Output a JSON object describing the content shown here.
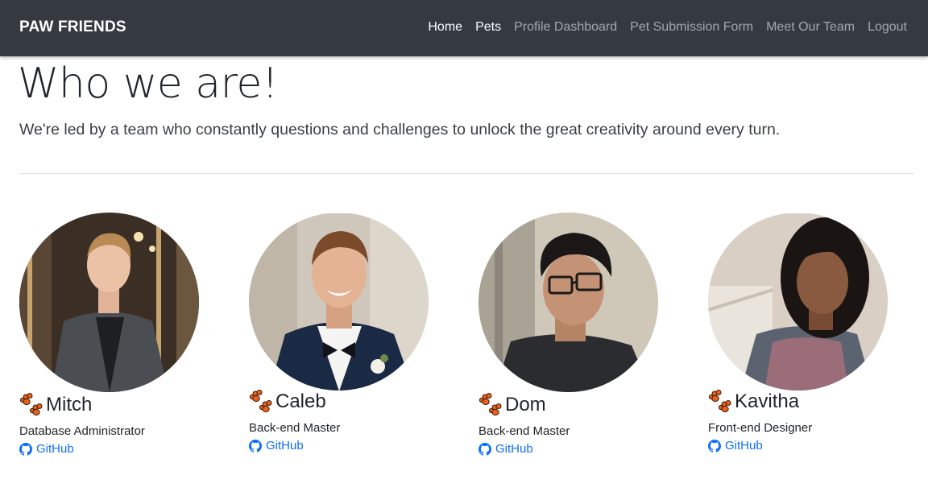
{
  "navbar": {
    "brand": "PAW FRIENDS",
    "links": [
      "Home",
      "Pets",
      "Profile Dashboard",
      "Pet Submission Form",
      "Meet Our Team",
      "Logout"
    ]
  },
  "hero": {
    "title": "Who we are!",
    "lead": "We're led by a team who constantly questions and challenges to unlock the great creativity around every turn."
  },
  "team": [
    {
      "name": "Mitch",
      "role": "Database Administrator",
      "link": "GitHub"
    },
    {
      "name": "Caleb",
      "role": "Back-end Master",
      "link": "GitHub"
    },
    {
      "name": "Dom",
      "role": "Back-end Master",
      "link": "GitHub"
    },
    {
      "name": "Kavitha",
      "role": "Front-end Designer",
      "link": "GitHub"
    }
  ],
  "colors": {
    "navbar": "#343a40",
    "link": "#0d6efd",
    "paw": "#e8621c"
  }
}
